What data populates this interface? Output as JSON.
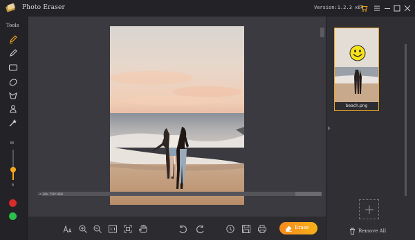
{
  "app": {
    "title": "Photo Eraser",
    "version": "Version:1.2.3 x64",
    "icons": [
      "app-logo-icon",
      "cart-icon",
      "menu-icon",
      "minimize-icon",
      "maximize-icon",
      "close-icon"
    ]
  },
  "tools": {
    "label": "Tools",
    "items": [
      {
        "name": "brush-tool",
        "icon": "brush-icon"
      },
      {
        "name": "eraser-pen-tool",
        "icon": "pen-icon"
      },
      {
        "name": "rectangle-tool",
        "icon": "rectangle-icon"
      },
      {
        "name": "lasso-tool",
        "icon": "lasso-icon"
      },
      {
        "name": "polygon-tool",
        "icon": "polygon-lasso-icon"
      },
      {
        "name": "person-select-tool",
        "icon": "person-icon"
      },
      {
        "name": "magic-tool",
        "icon": "magic-wand-icon"
      }
    ],
    "brush_size": {
      "max": "30",
      "min": "0",
      "level": 0.35,
      "accent": "#f4a81d"
    },
    "swatches": [
      "#d92b2b",
      "#2dbf4a"
    ]
  },
  "canvas": {
    "zoom_info": "34.00% 750*1000"
  },
  "bottom_toolbar": {
    "icons": [
      "text-size-icon",
      "zoom-in-icon",
      "zoom-out-icon",
      "actual-size-icon",
      "fit-screen-icon",
      "hand-icon",
      "undo-icon",
      "redo-icon",
      "history-icon",
      "save-icon",
      "print-icon"
    ],
    "erase_label": "Erase"
  },
  "files": {
    "items": [
      {
        "name": "beach.png"
      }
    ],
    "remove_all_label": "Remove All"
  },
  "colors": {
    "accent": "#f4a81d",
    "titlebar": "#232327",
    "canvas_bg": "#3a3a40"
  }
}
